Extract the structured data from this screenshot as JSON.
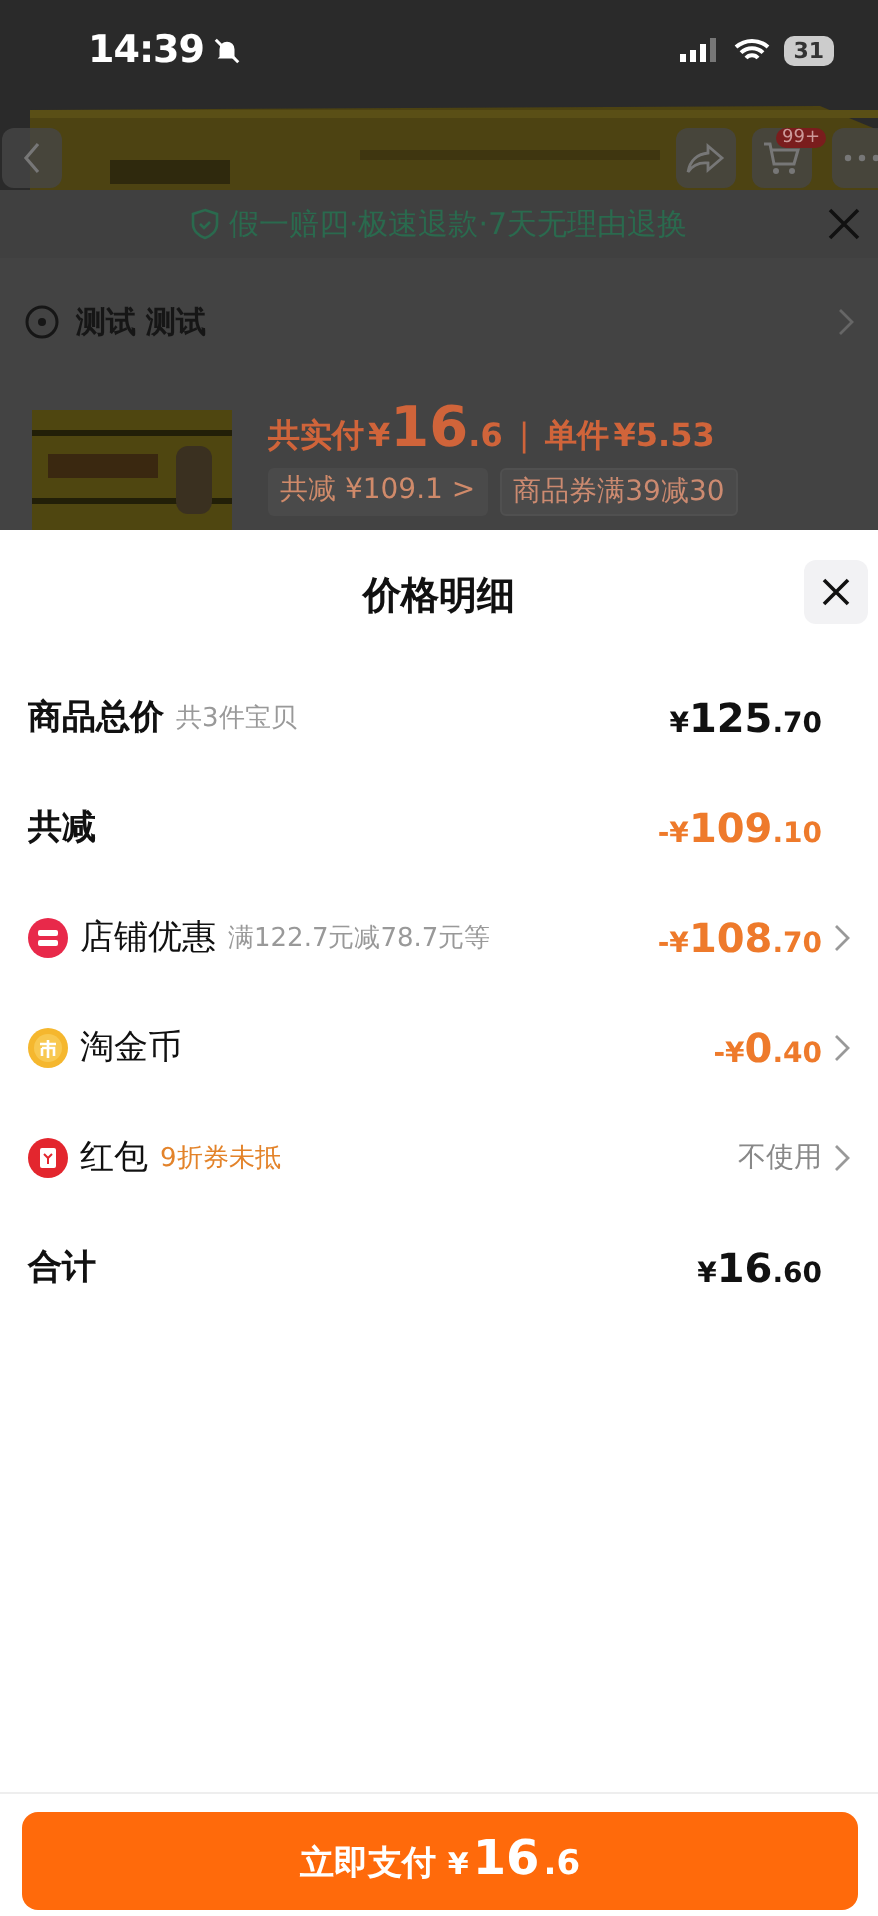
{
  "status_bar": {
    "time": "14:39",
    "battery": "31"
  },
  "product_header": {
    "cart_badge": "99+"
  },
  "guarantee_banner": {
    "text": "假一赔四·极速退款·7天无理由退换"
  },
  "address": {
    "text": "测试 测试"
  },
  "product": {
    "paid_label": "共实付",
    "currency": "¥",
    "paid_integer": "16",
    "paid_decimal": ".6",
    "separator": "|",
    "unit_label": "单件",
    "unit_price": "¥5.53",
    "tags": [
      {
        "text": "共减 ¥109.1 >",
        "kind": "discount"
      },
      {
        "text": "商品券满39减30",
        "kind": "coupon"
      }
    ]
  },
  "sheet": {
    "title": "价格明细"
  },
  "rows": [
    {
      "kind": "plain",
      "label": "商品总价",
      "note": "共3件宝贝",
      "prefix": "¥",
      "integer": "125",
      "decimal": ".70",
      "color": "#111111",
      "chevron": false
    },
    {
      "kind": "plain",
      "label": "共减",
      "prefix": "-¥",
      "integer": "109",
      "decimal": ".10",
      "color": "#ee7a2b",
      "chevron": false
    },
    {
      "kind": "shop",
      "label": "店铺优惠",
      "note": "满122.7元减78.7元等",
      "prefix": "-¥",
      "integer": "108",
      "decimal": ".70",
      "color": "#ee7a2b",
      "chevron": true
    },
    {
      "kind": "coin",
      "label": "淘金币",
      "prefix": "-¥",
      "integer": "0",
      "decimal": ".40",
      "color": "#ee7a2b",
      "chevron": true
    },
    {
      "kind": "redpacket",
      "label": "红包",
      "note": "9折券未抵",
      "value_text": "不使用",
      "chevron": true
    },
    {
      "kind": "plain",
      "label": "合计",
      "prefix": "¥",
      "integer": "16",
      "decimal": ".60",
      "color": "#111111",
      "chevron": false
    }
  ],
  "pay_button": {
    "label": "立即支付",
    "currency": "¥",
    "integer": "16",
    "decimal": ".6"
  }
}
